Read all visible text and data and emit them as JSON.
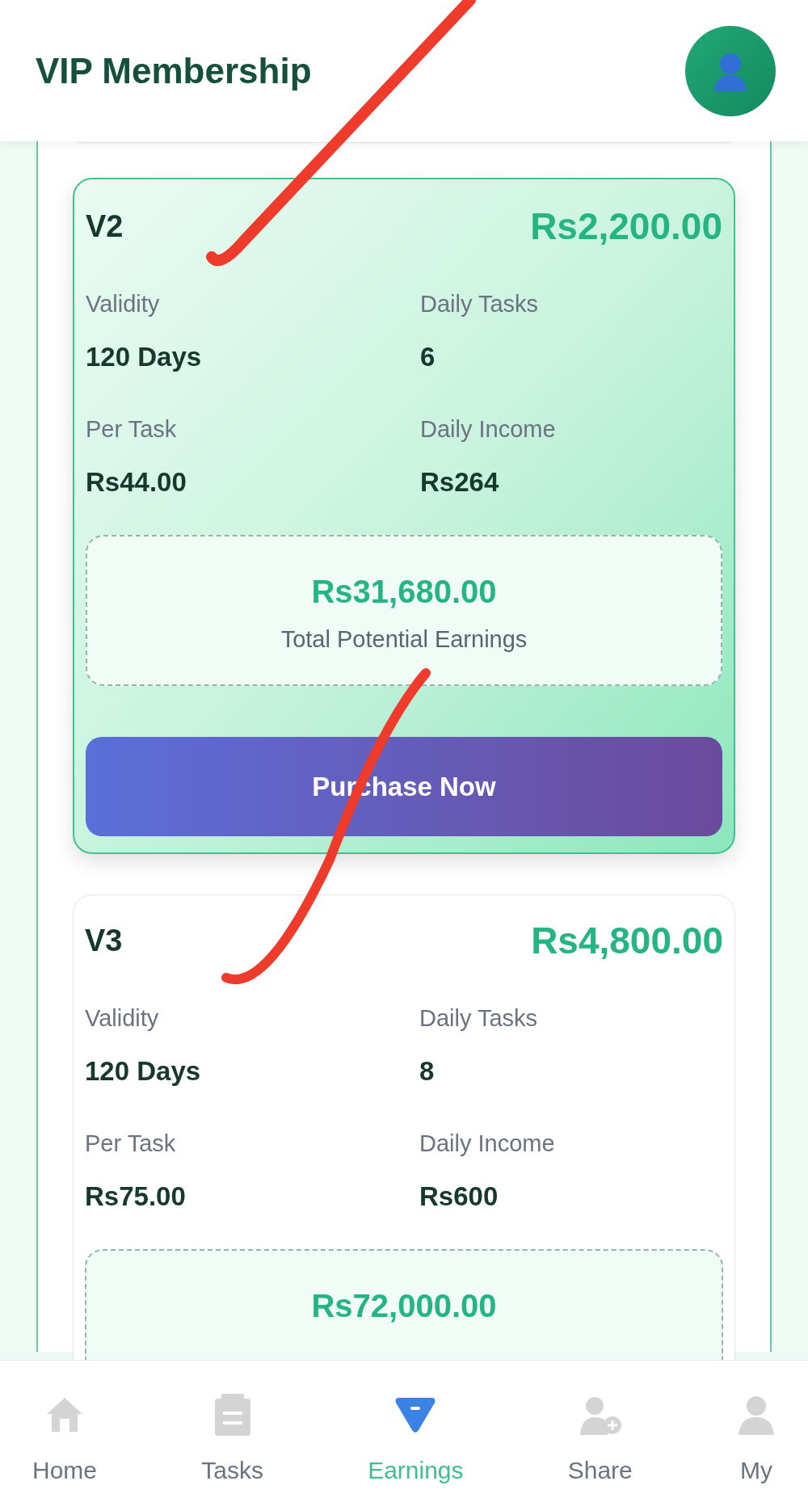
{
  "header": {
    "title": "VIP Membership"
  },
  "plans": [
    {
      "name": "V2",
      "price": "Rs2,200.00",
      "featured": true,
      "stats": [
        {
          "label": "Validity",
          "value": "120 Days"
        },
        {
          "label": "Daily Tasks",
          "value": "6"
        },
        {
          "label": "Per Task",
          "value": "Rs44.00"
        },
        {
          "label": "Daily Income",
          "value": "Rs264"
        }
      ],
      "total": "Rs31,680.00",
      "total_label": "Total Potential Earnings",
      "button": "Purchase Now"
    },
    {
      "name": "V3",
      "price": "Rs4,800.00",
      "featured": false,
      "stats": [
        {
          "label": "Validity",
          "value": "120 Days"
        },
        {
          "label": "Daily Tasks",
          "value": "8"
        },
        {
          "label": "Per Task",
          "value": "Rs75.00"
        },
        {
          "label": "Daily Income",
          "value": "Rs600"
        }
      ],
      "total": "Rs72,000.00"
    }
  ],
  "nav": [
    {
      "label": "Home",
      "kind": "home",
      "selected": false
    },
    {
      "label": "Tasks",
      "kind": "tasks",
      "selected": false
    },
    {
      "label": "Earnings",
      "kind": "earnings",
      "selected": true
    },
    {
      "label": "Share",
      "kind": "share",
      "selected": false
    },
    {
      "label": "My",
      "kind": "my",
      "selected": false
    }
  ]
}
